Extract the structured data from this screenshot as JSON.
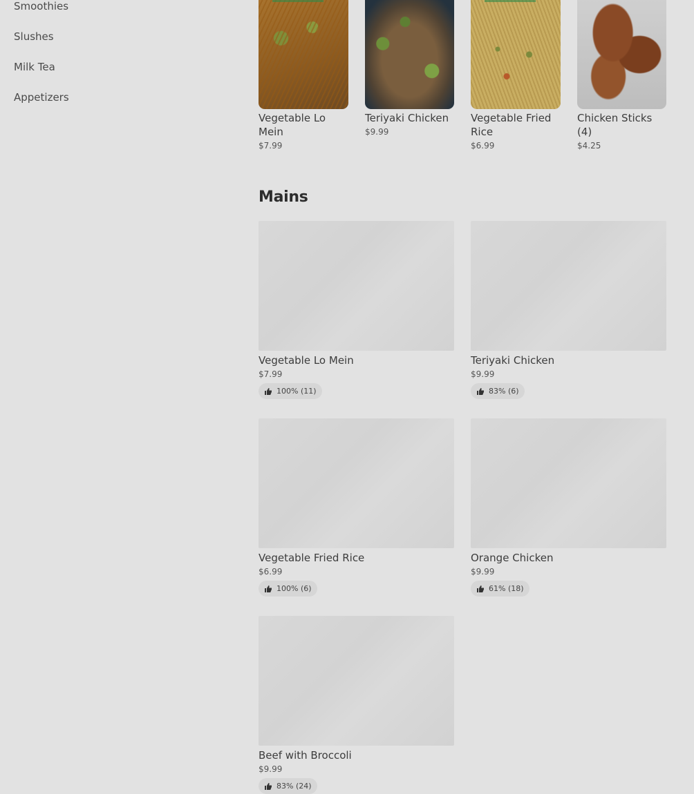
{
  "sidebar": {
    "items": [
      {
        "label": "Smoothies"
      },
      {
        "label": "Slushes"
      },
      {
        "label": "Milk Tea"
      },
      {
        "label": "Appetizers"
      }
    ]
  },
  "featured": [
    {
      "name": "Vegetable Lo Mein",
      "price": "$7.99"
    },
    {
      "name": "Teriyaki Chicken",
      "price": "$9.99"
    },
    {
      "name": "Vegetable Fried Rice",
      "price": "$6.99"
    },
    {
      "name": "Chicken Sticks (4)",
      "price": "$4.25"
    }
  ],
  "section": {
    "title": "Mains"
  },
  "mains": [
    {
      "name": "Vegetable Lo Mein",
      "price": "$7.99",
      "rating": "100% (11)"
    },
    {
      "name": "Teriyaki Chicken",
      "price": "$9.99",
      "rating": "83% (6)"
    },
    {
      "name": "Vegetable Fried Rice",
      "price": "$6.99",
      "rating": "100% (6)"
    },
    {
      "name": "Orange Chicken",
      "price": "$9.99",
      "rating": "61% (18)"
    },
    {
      "name": "Beef with Broccoli",
      "price": "$9.99",
      "rating": "83% (24)"
    }
  ]
}
